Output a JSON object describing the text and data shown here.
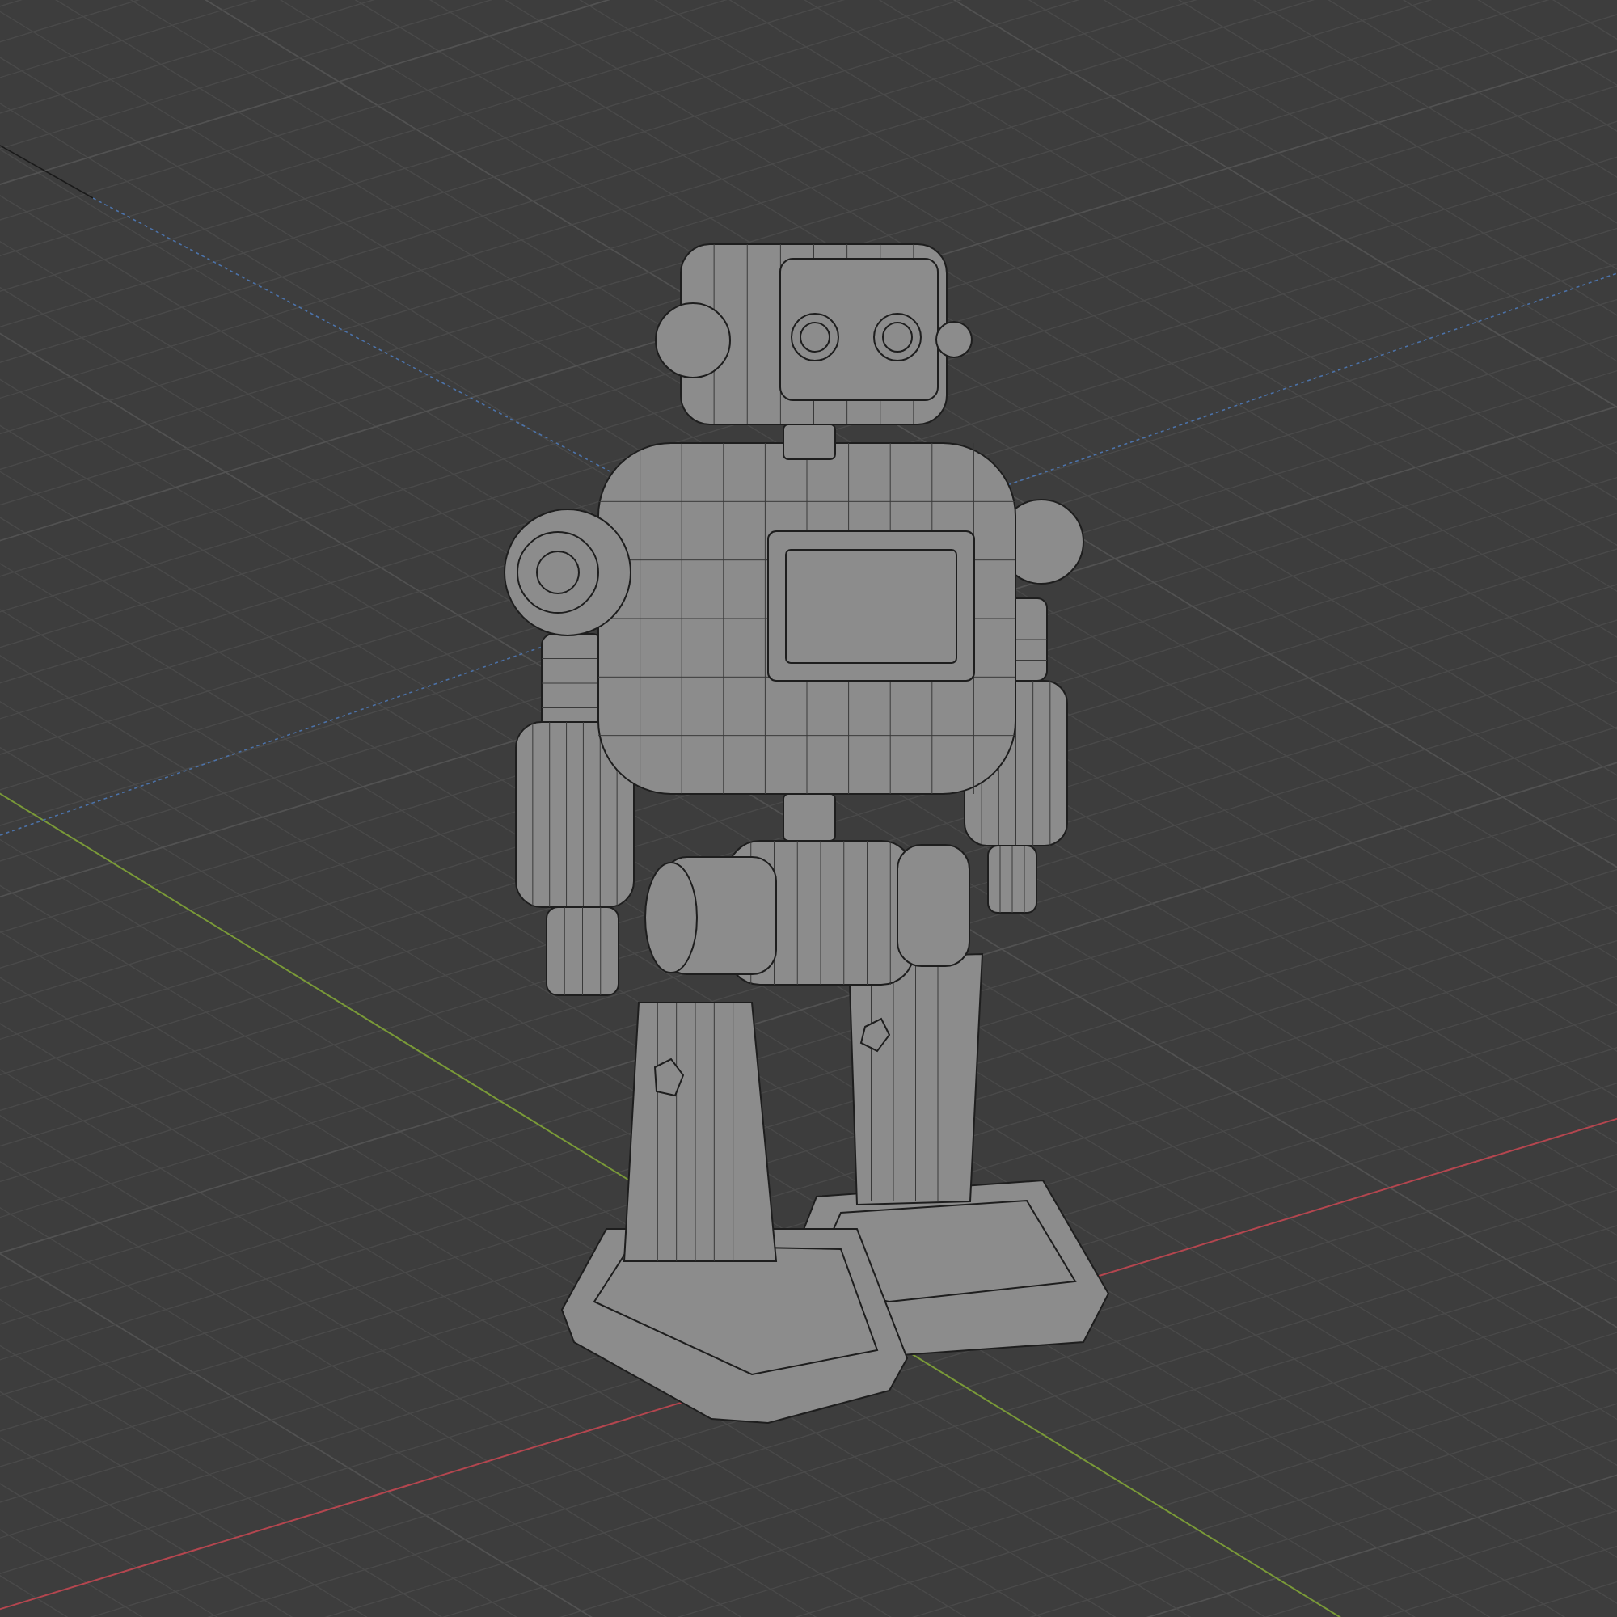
{
  "viewport": {
    "axes": [
      {
        "kind": "x",
        "color": "#b4464f"
      },
      {
        "kind": "y",
        "color": "#7a9a38"
      },
      {
        "kind": "guide",
        "color": "#4c72a8"
      }
    ]
  }
}
